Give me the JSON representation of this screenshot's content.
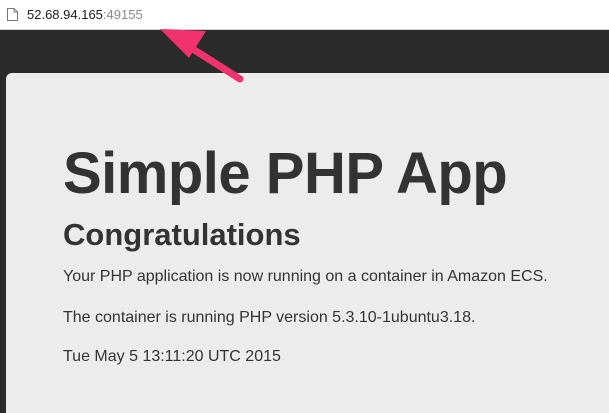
{
  "browser": {
    "url_host": "52.68.94.165",
    "url_port": ":49155"
  },
  "page": {
    "title": "Simple PHP App",
    "heading": "Congratulations",
    "paragraphs": [
      "Your PHP application is now running on a container in Amazon ECS.",
      "The container is running PHP version 5.3.10-1ubuntu3.18.",
      "Tue May 5 13:11:20 UTC 2015"
    ]
  },
  "colors": {
    "annotation_arrow": "#f0336e",
    "background_dark": "#2b2b2b",
    "panel": "#ececec",
    "text": "#333333"
  },
  "icons": {
    "page_icon": "page-icon",
    "annotation": "arrow-annotation-icon"
  }
}
